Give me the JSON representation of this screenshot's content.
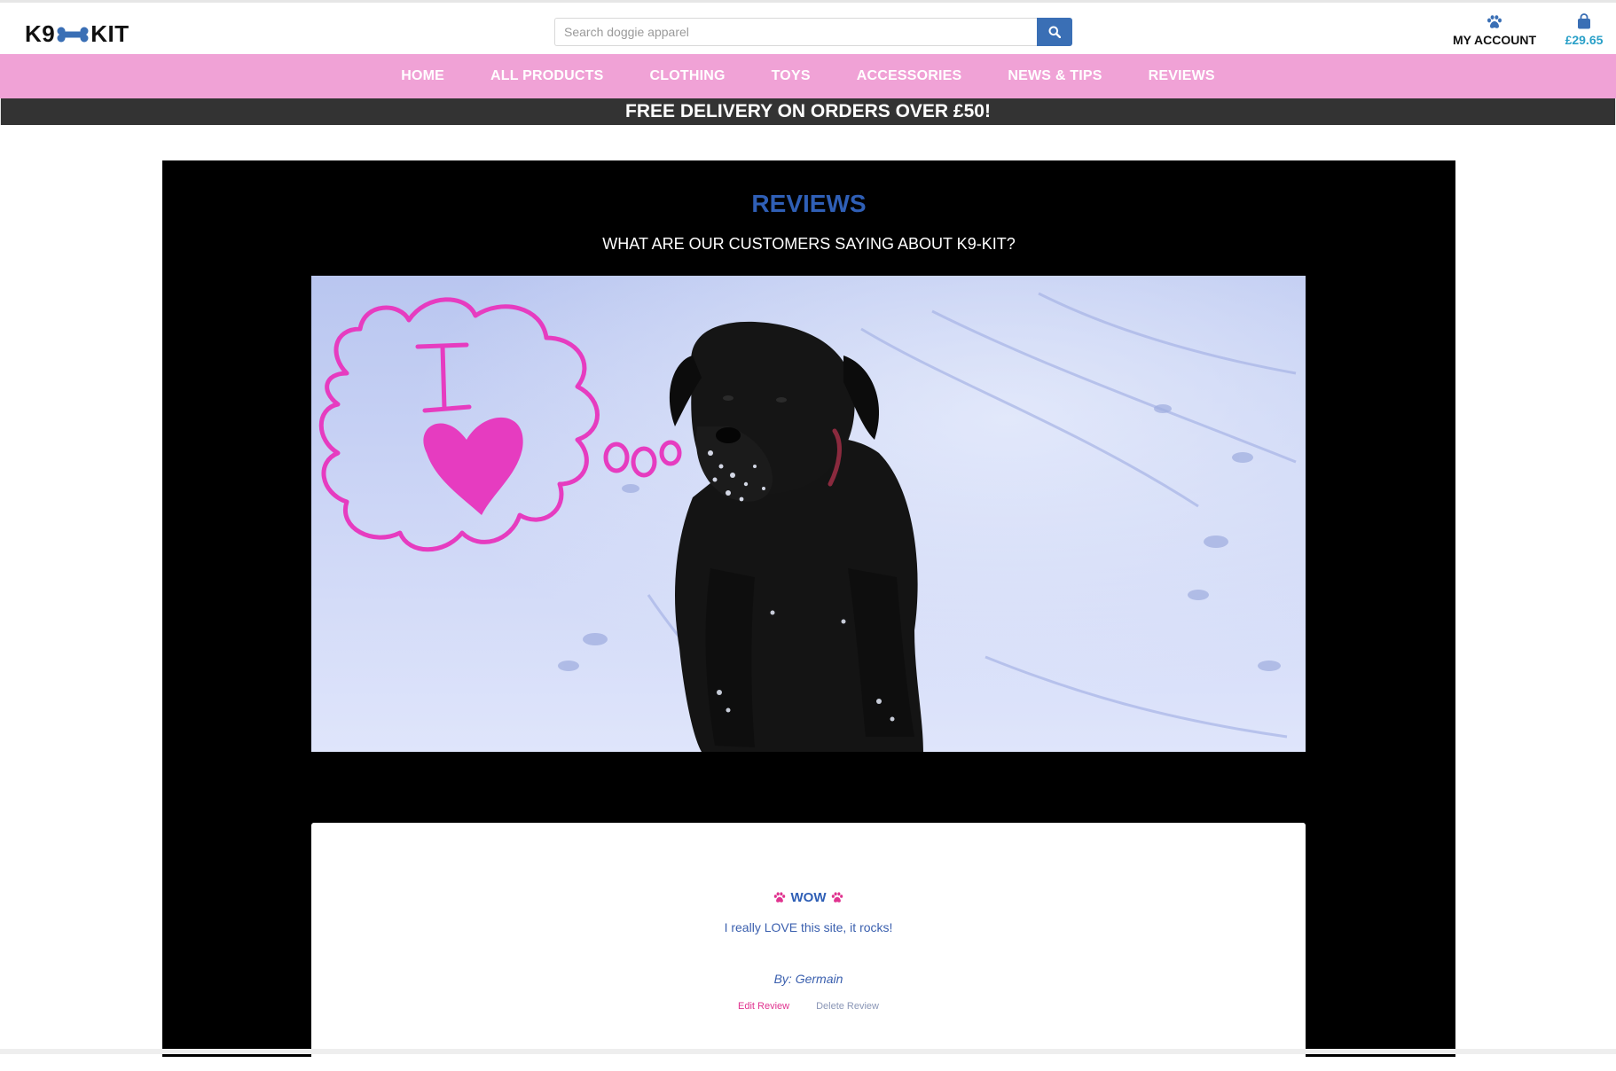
{
  "header": {
    "logo_left": "K9",
    "logo_right": "KIT",
    "search_placeholder": "Search doggie apparel",
    "search_value": "",
    "account_label": "MY ACCOUNT",
    "bag_total": "£29.65"
  },
  "nav": {
    "items": [
      {
        "label": "HOME"
      },
      {
        "label": "ALL PRODUCTS"
      },
      {
        "label": "CLOTHING"
      },
      {
        "label": "TOYS"
      },
      {
        "label": "ACCESSORIES"
      },
      {
        "label": "NEWS & TIPS"
      },
      {
        "label": "REVIEWS"
      }
    ]
  },
  "promo": {
    "text": "FREE DELIVERY ON ORDERS OVER £50!"
  },
  "reviews": {
    "title": "REVIEWS",
    "subtitle": "WHAT ARE OUR CUSTOMERS SAYING ABOUT K9-KIT?"
  },
  "hero_image": {
    "drawing_text": "I"
  },
  "review_card": {
    "title": "WOW",
    "body": "I really LOVE this site, it rocks!",
    "author": "By: Germain",
    "edit_label": "Edit Review",
    "delete_label": "Delete Review"
  },
  "colors": {
    "nav_bg": "#f0a2d6",
    "promo_bg": "#333333",
    "accent_blue": "#2f5fb6",
    "search_button": "#3a6fb5",
    "bag_total": "#2aa0c8",
    "paw_pink": "#e0338f",
    "drawing_pink": "#e63cc0"
  },
  "icons": {
    "search": "search-icon",
    "account": "paw-icon",
    "bag": "shopping-bag-icon",
    "logo_bone": "bone-icon",
    "title_paw": "paw-icon"
  }
}
